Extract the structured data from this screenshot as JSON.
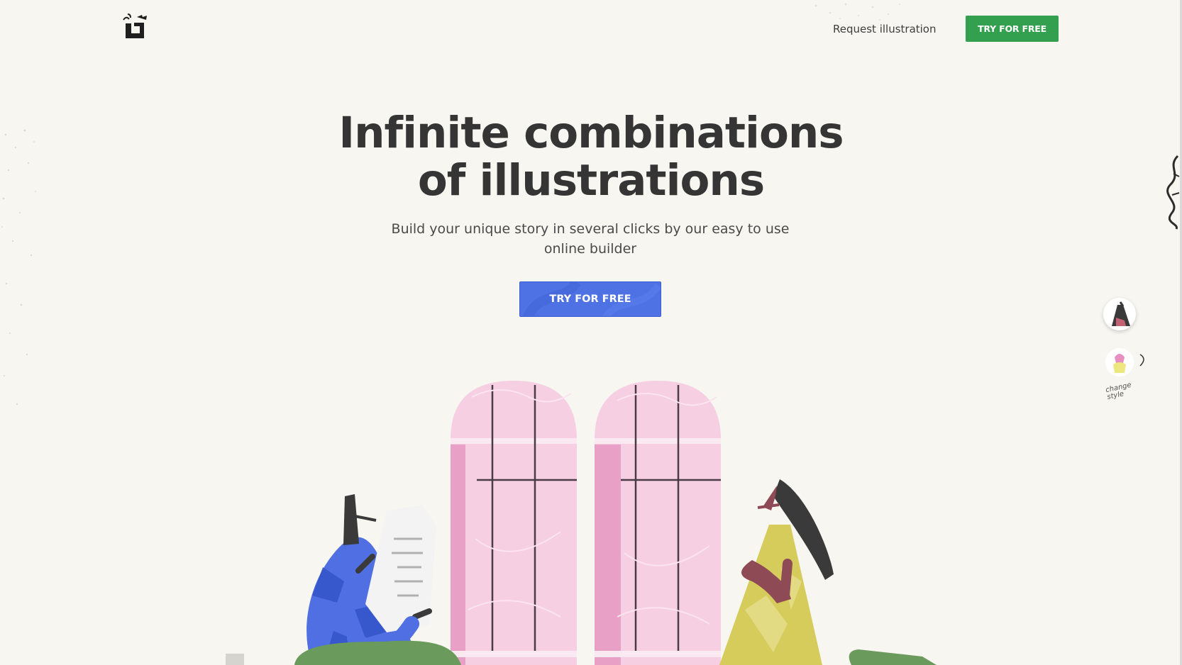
{
  "header": {
    "logo_icon": "cat-face-logo-icon",
    "request_link": "Request illustration",
    "cta_label": "TRY FOR FREE",
    "cta_color": "#33a04f"
  },
  "hero": {
    "title_line1": "Infinite combinations",
    "title_line2": "of illustrations",
    "subtitle": "Build your unique story in several clicks by our easy to use online builder",
    "cta_label": "TRY FOR FREE",
    "cta_color": "#4e72e4"
  },
  "style_switcher": {
    "caption_line1": "change",
    "caption_line2": "style"
  },
  "colors": {
    "background": "#f8f6f0",
    "window_pink": "#f4c7de",
    "blue_person": "#4f6fe2",
    "yellow_person": "#d6cc5c",
    "green_seat": "#6b9a5d"
  }
}
